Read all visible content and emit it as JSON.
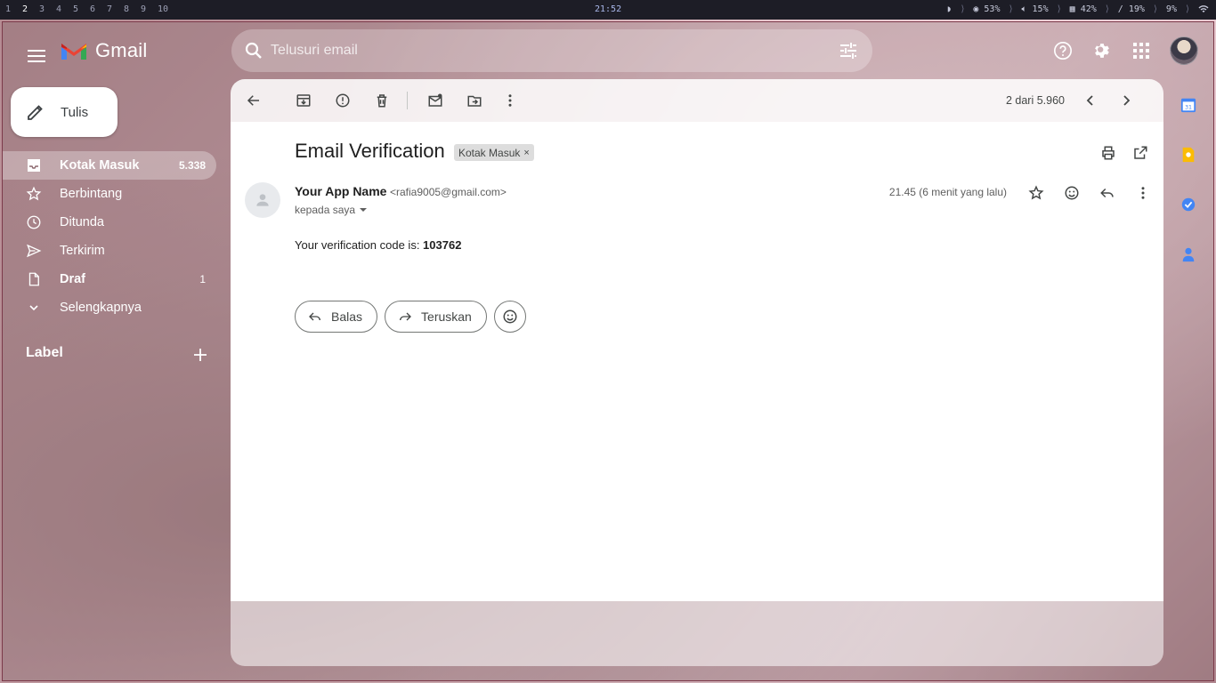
{
  "system_bar": {
    "workspaces": [
      "1",
      "2",
      "3",
      "4",
      "5",
      "6",
      "7",
      "8",
      "9",
      "10"
    ],
    "active_workspace": "2",
    "clock": "21:52",
    "status": {
      "cpu": "53%",
      "volume": "15%",
      "memory": "42%",
      "disk": "/ 19%",
      "extra": "9%"
    }
  },
  "app": {
    "brand": "Gmail",
    "search_placeholder": "Telusuri email"
  },
  "sidebar": {
    "compose_label": "Tulis",
    "items": [
      {
        "label": "Kotak Masuk",
        "count": "5.338",
        "icon": "inbox-icon"
      },
      {
        "label": "Berbintang",
        "count": "",
        "icon": "star-icon"
      },
      {
        "label": "Ditunda",
        "count": "",
        "icon": "clock-icon"
      },
      {
        "label": "Terkirim",
        "count": "",
        "icon": "send-icon"
      },
      {
        "label": "Draf",
        "count": "1",
        "icon": "draft-icon"
      },
      {
        "label": "Selengkapnya",
        "count": "",
        "icon": "chevron-down-icon"
      }
    ],
    "labels_heading": "Label"
  },
  "toolbar": {
    "pager": "2 dari 5.960"
  },
  "email": {
    "subject": "Email Verification",
    "label_chip": "Kotak Masuk",
    "label_chip_close": "×",
    "sender_name": "Your App Name",
    "sender_email": "<rafia9005@gmail.com>",
    "recipient": "kepada saya",
    "time": "21.45 (6 menit yang lalu)",
    "body_prefix": "Your verification code is: ",
    "verification_code": "103762"
  },
  "reply_actions": {
    "reply": "Balas",
    "forward": "Teruskan"
  },
  "colors": {
    "accent_red": "#ea4335",
    "gmail_blue": "#4285f4",
    "gmail_green": "#34a853",
    "gmail_yellow": "#fbbc04"
  }
}
